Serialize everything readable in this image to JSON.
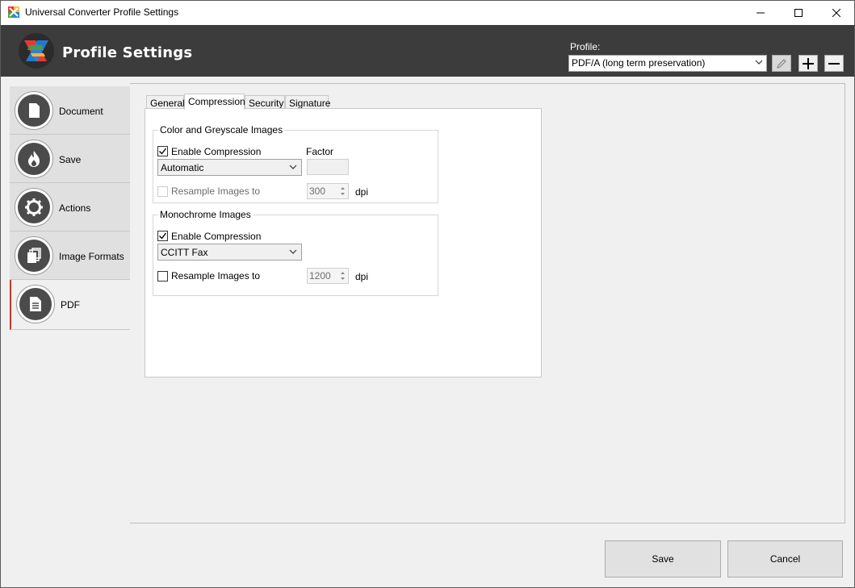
{
  "window": {
    "title": "Universal Converter Profile Settings",
    "controls": [
      "minimize-icon",
      "maximize-icon",
      "close-icon"
    ]
  },
  "header": {
    "title": "Profile Settings",
    "profile_label": "Profile:",
    "profile_value": "PDF/A (long term preservation)",
    "buttons": [
      "edit-icon",
      "plus-icon",
      "minus-icon"
    ]
  },
  "sidebar": {
    "items": [
      {
        "label": "Document",
        "icon": "document-icon"
      },
      {
        "label": "Save",
        "icon": "flame-icon"
      },
      {
        "label": "Actions",
        "icon": "gear-icon"
      },
      {
        "label": "Image Formats",
        "icon": "copy-icon"
      },
      {
        "label": "PDF",
        "icon": "pdf-file-icon"
      }
    ],
    "active": "PDF",
    "accent_color": "#c0392b"
  },
  "tabs": {
    "items": [
      "General",
      "Compression",
      "Security",
      "Signature"
    ],
    "active": "Compression"
  },
  "color_group": {
    "title": "Color and Greyscale Images",
    "enable_label": "Enable Compression",
    "enable_checked": true,
    "factor_label": "Factor",
    "method": "Automatic",
    "resample_label": "Resample Images to",
    "resample_checked": false,
    "resample_value": "300",
    "unit": "dpi"
  },
  "mono_group": {
    "title": "Monochrome Images",
    "enable_label": "Enable Compression",
    "enable_checked": true,
    "method": "CCITT Fax",
    "resample_label": "Resample Images to",
    "resample_checked": false,
    "resample_value": "1200",
    "unit": "dpi"
  },
  "footer": {
    "save_label": "Save",
    "cancel_label": "Cancel"
  }
}
